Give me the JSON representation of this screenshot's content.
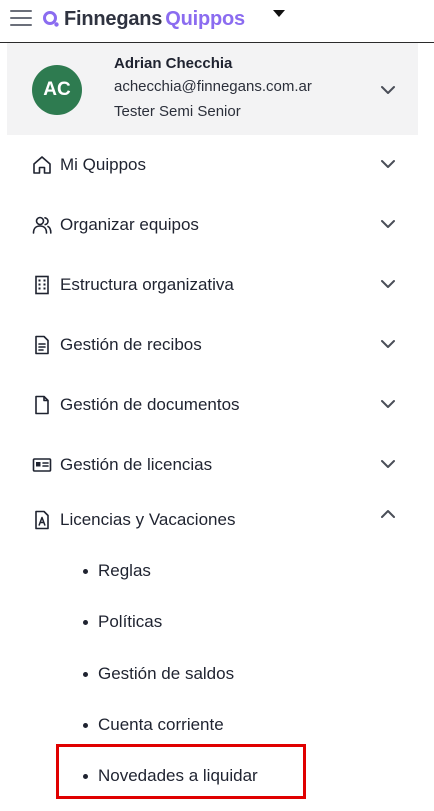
{
  "brand": {
    "name_part1": "Finnegans",
    "name_part2": "Quippos",
    "accent": "#8b6cf0"
  },
  "user": {
    "initials": "AC",
    "name": "Adrian Checchia",
    "email": "achecchia@finnegans.com.ar",
    "role": "Tester Semi Senior",
    "avatar_color": "#2e7b50"
  },
  "menu": [
    {
      "label": "Mi Quippos",
      "icon": "home-icon",
      "state": "collapsed"
    },
    {
      "label": "Organizar equipos",
      "icon": "users-icon",
      "state": "collapsed"
    },
    {
      "label": "Estructura organizativa",
      "icon": "building-icon",
      "state": "collapsed"
    },
    {
      "label": "Gestión de recibos",
      "icon": "receipt-icon",
      "state": "collapsed"
    },
    {
      "label": "Gestión de documentos",
      "icon": "document-icon",
      "state": "collapsed"
    },
    {
      "label": "Gestión de licencias",
      "icon": "id-card-icon",
      "state": "collapsed"
    },
    {
      "label": "Licencias y Vacaciones",
      "icon": "file-a-icon",
      "state": "expanded",
      "children": [
        "Reglas",
        "Políticas",
        "Gestión de saldos",
        "Cuenta corriente",
        "Novedades a liquidar"
      ]
    }
  ],
  "highlight_color": "#e00000"
}
